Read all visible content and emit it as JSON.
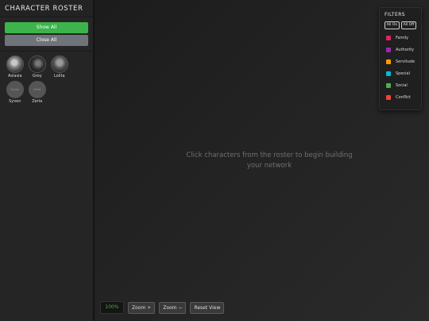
{
  "sidebar": {
    "title": "CHARACTER ROSTER",
    "show_all_label": "Show All",
    "close_all_label": "Close All",
    "characters": [
      {
        "name": "Aslasia",
        "avatar_text": ""
      },
      {
        "name": "Grey",
        "avatar_text": ""
      },
      {
        "name": "Lolita",
        "avatar_text": ""
      },
      {
        "name": "Syven",
        "avatar_text": "Syven"
      },
      {
        "name": "Zeria",
        "avatar_text": "Zeria"
      }
    ]
  },
  "canvas": {
    "placeholder": "Click characters from the roster to begin building your network"
  },
  "filters": {
    "title": "FILTERS",
    "all_on_label": "All On",
    "all_off_label": "All Off",
    "items": [
      {
        "label": "Family",
        "color": "#e0245e"
      },
      {
        "label": "Authority",
        "color": "#9c27b0"
      },
      {
        "label": "Servitude",
        "color": "#ff9800"
      },
      {
        "label": "Special",
        "color": "#00bcd4"
      },
      {
        "label": "Social",
        "color": "#4caf50"
      },
      {
        "label": "Conflict",
        "color": "#f44336"
      }
    ]
  },
  "controls": {
    "zoom_level": "100%",
    "zoom_in_label": "Zoom +",
    "zoom_out_label": "Zoom −",
    "reset_label": "Reset View"
  }
}
